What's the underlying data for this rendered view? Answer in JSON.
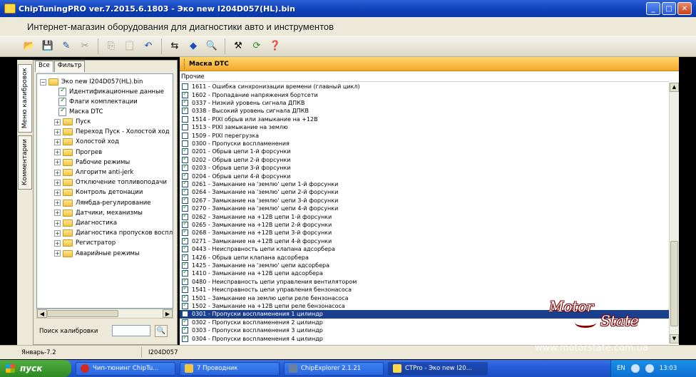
{
  "window": {
    "title": "ChipTuningPRO ver.7.2015.6.1803 - Эко new I204D057(HL).bin",
    "minimize": "_",
    "maximize": "□",
    "close": "✕"
  },
  "banner": "Интернет-магазин оборудования для диагностики авто и инструментов",
  "side_tabs": {
    "calibration_menu": "Меню калибровок",
    "comments": "Комментарии"
  },
  "left": {
    "tabs": [
      "Все",
      "Фильтр"
    ],
    "tree": {
      "root": "Эко new I204D057(HL).bin",
      "files": [
        "Идентификационные данные",
        "Флаги комплектации",
        "Маска DTC"
      ],
      "folders": [
        "Пуск",
        "Переход Пуск - Холостой ход",
        "Холостой ход",
        "Прогрев",
        "Рабочие режимы",
        "Алгоритм anti-jerk",
        "Отключение топливоподачи",
        "Контроль детонации",
        "Лямбда-регулирование",
        "Датчики, механизмы",
        "Диагностика",
        "Диагностика пропусков воспламенения",
        "Регистратор",
        "Аварийные режимы"
      ]
    },
    "search_label": "Поиск калибровки",
    "search_value": ""
  },
  "mask": {
    "header": "Маска DTC",
    "group": "Прочие",
    "rows": [
      {
        "text": "1611 - Ошибка синхронизации времени (главный цикл)",
        "checked": false
      },
      {
        "text": "1602 - Пропадание напряжения бортсети",
        "checked": true
      },
      {
        "text": "0337 - Низкий уровень сигнала ДПКВ",
        "checked": true
      },
      {
        "text": "0338 - Высокий уровень сигнала ДПКВ",
        "checked": true
      },
      {
        "text": "1514 - PIXI обрыв или замыкание на +12В",
        "checked": false
      },
      {
        "text": "1513 - PIXI замыкание на землю",
        "checked": false
      },
      {
        "text": "1509 - PIXI перегрузка",
        "checked": false
      },
      {
        "text": "0300 - Пропуски воспламенения",
        "checked": false
      },
      {
        "text": "0201 - Обрыв цепи 1-й форсунки",
        "checked": true
      },
      {
        "text": "0202 - Обрыв цепи 2-й форсунки",
        "checked": true
      },
      {
        "text": "0203 - Обрыв цепи 3-й форсунки",
        "checked": true
      },
      {
        "text": "0204 - Обрыв цепи 4-й форсунки",
        "checked": true
      },
      {
        "text": "0261 - Замыкание на 'землю' цепи 1-й форсунки",
        "checked": true
      },
      {
        "text": "0264 - Замыкание на 'землю' цепи 2-й форсунки",
        "checked": true
      },
      {
        "text": "0267 - Замыкание на 'землю' цепи 3-й форсунки",
        "checked": true
      },
      {
        "text": "0270 - Замыкание на 'землю' цепи 4-й форсунки",
        "checked": true
      },
      {
        "text": "0262 - Замыкание на +12В цепи 1-й форсунки",
        "checked": true
      },
      {
        "text": "0265 - Замыкание на +12В цепи 2-й форсунки",
        "checked": true
      },
      {
        "text": "0268 - Замыкание на +12В цепи 3-й форсунки",
        "checked": true
      },
      {
        "text": "0271 - Замыкание на +12В цепи 4-й форсунки",
        "checked": true
      },
      {
        "text": "0443 - Неисправность цепи клапана адсорбера",
        "checked": true
      },
      {
        "text": "1426 - Обрыв цепи клапана адсорбера",
        "checked": true
      },
      {
        "text": "1425 - Замыкание на 'землю' цепи адсорбера",
        "checked": true
      },
      {
        "text": "1410 - Замыкание на +12В цепи адсорбера",
        "checked": true
      },
      {
        "text": "0480 - Неисправность цепи управления вентилятором",
        "checked": true
      },
      {
        "text": "1541 - Неисправность цепи управления бензонасоса",
        "checked": true
      },
      {
        "text": "1501 - Замыкание на землю цепи реле бензонасоса",
        "checked": true
      },
      {
        "text": "1502 - Замыкание на +12В цепи реле бензонасоса",
        "checked": true
      },
      {
        "text": "0301 - Пропуски воспламенения 1 цилиндр",
        "checked": false,
        "selected": true
      },
      {
        "text": "0302 - Пропуски воспламенения 2 цилиндр",
        "checked": true
      },
      {
        "text": "0303 - Пропуски воспламенения 3 цилиндр",
        "checked": true
      },
      {
        "text": "0304 - Пропуски воспламенения 4 цилиндр",
        "checked": true
      }
    ]
  },
  "logo": {
    "word1": "Motor",
    "word2": "State"
  },
  "status": {
    "left": "Январь-7.2",
    "right": "I204D057"
  },
  "watermark": "www.motorstate.com.ua",
  "taskbar": {
    "start": "пуск",
    "tasks": [
      "Чип-тюнинг ChipTu...",
      "7 Проводник",
      "ChipExplorer 2.1.21",
      "CTPro - Эко new I20..."
    ],
    "lang": "EN",
    "clock": "13:03"
  },
  "colors": {
    "accent_header": "#f3a92b",
    "selection": "#1a3f8f",
    "titlebar": "#0d3fb8"
  }
}
